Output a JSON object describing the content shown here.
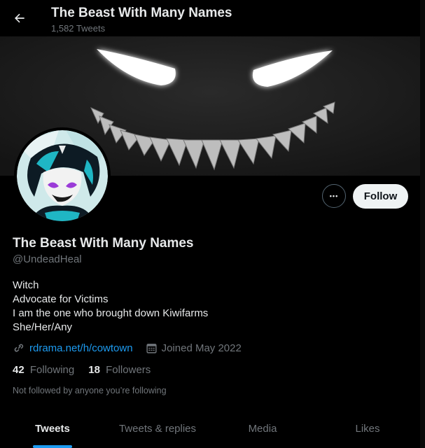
{
  "topbar": {
    "title": "The Beast With Many Names",
    "tweet_count": "1,582 Tweets"
  },
  "profile": {
    "name": "The Beast With Many Names",
    "handle": "@UndeadHeal",
    "bio": [
      "Witch",
      "Advocate for Victims",
      "I am the one who brought down Kiwifarms",
      "She/Her/Any"
    ],
    "website": "rdrama.net/h/cowtown",
    "joined": "Joined May 2022",
    "following_count": "42",
    "following_label": "Following",
    "followers_count": "18",
    "followers_label": "Followers",
    "not_followed_text": "Not followed by anyone you’re following"
  },
  "actions": {
    "more_label": "•••",
    "follow_label": "Follow"
  },
  "tabs": [
    {
      "label": "Tweets",
      "active": true
    },
    {
      "label": "Tweets & replies",
      "active": false
    },
    {
      "label": "Media",
      "active": false
    },
    {
      "label": "Likes",
      "active": false
    }
  ],
  "colors": {
    "accent": "#1d9bf0",
    "background": "#000000",
    "muted": "#71767b"
  },
  "icons": {
    "back": "arrow-left-icon",
    "link": "link-icon",
    "calendar": "calendar-icon"
  }
}
